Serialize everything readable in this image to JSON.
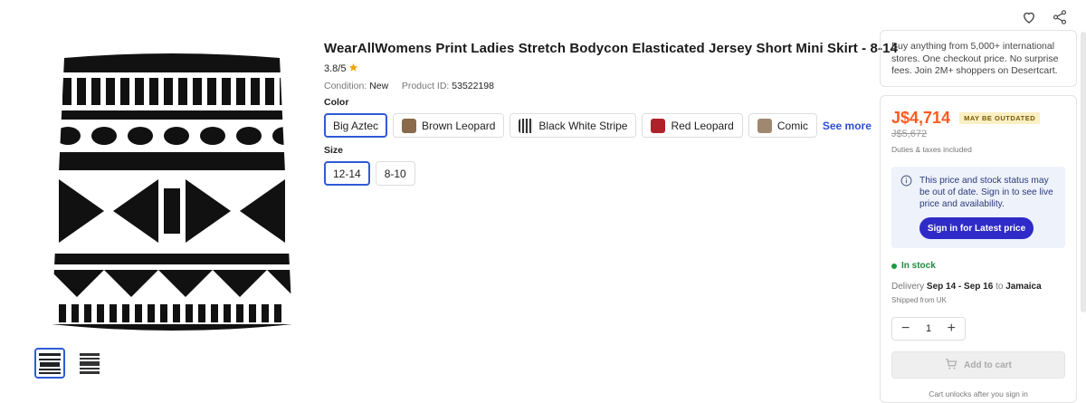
{
  "product": {
    "title": "WearAllWomens Print Ladies Stretch Bodycon Elasticated Jersey Short Mini Skirt - 8-14",
    "rating": "3.8/5",
    "condition_label": "Condition:",
    "condition_value": "New",
    "product_id_label": "Product ID:",
    "product_id_value": "53522198"
  },
  "color": {
    "label": "Color",
    "options": [
      {
        "label": "Big Aztec",
        "selected": true,
        "swatch": null
      },
      {
        "label": "Brown Leopard",
        "selected": false,
        "swatch": "#8a6a4a"
      },
      {
        "label": "Black White Stripe",
        "selected": false,
        "swatch": "#555555"
      },
      {
        "label": "Red Leopard",
        "selected": false,
        "swatch": "#b0222a"
      },
      {
        "label": "Comic",
        "selected": false,
        "swatch": "#a08870"
      }
    ],
    "see_more": "See more"
  },
  "size": {
    "label": "Size",
    "options": [
      {
        "label": "12-14",
        "selected": true
      },
      {
        "label": "8-10",
        "selected": false
      }
    ]
  },
  "promo": {
    "text": "Buy anything from 5,000+ international stores. One checkout price. No surprise fees. Join 2M+ shoppers on Desertcart."
  },
  "buy_box": {
    "price": "J$4,714",
    "outdated_badge": "MAY BE OUTDATED",
    "old_price": "J$5,672",
    "duties": "Duties & taxes included",
    "notice": "This price and stock status may be out of date. Sign in to see live price and availability.",
    "signin_button": "Sign in for Latest price",
    "stock": "In stock",
    "delivery_label": "Delivery",
    "delivery_dates": "Sep 14 - Sep 16",
    "delivery_to": "to",
    "delivery_country": "Jamaica",
    "shipped_from": "Shipped from UK",
    "quantity": "1",
    "add_to_cart": "Add to cart",
    "cart_unlock": "Cart unlocks after you sign in"
  },
  "colors": {
    "accent": "#2d5bd6",
    "price": "#ff5a1f",
    "signin": "#2f2bc8",
    "stock": "#1f8a3c"
  },
  "icons": [
    "heart-icon",
    "share-icon",
    "star-icon",
    "info-icon",
    "minus-icon",
    "plus-icon",
    "cart-icon"
  ]
}
